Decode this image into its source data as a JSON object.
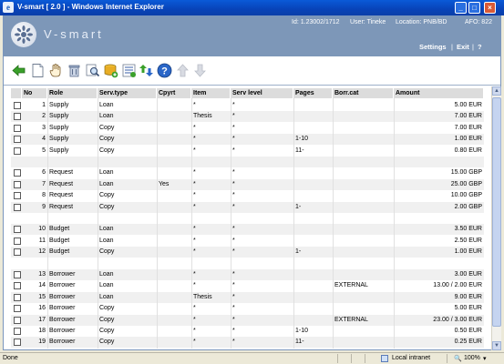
{
  "window": {
    "title": "V-smart [ 2.0 ] - Windows Internet Explorer"
  },
  "header": {
    "logo_text": "V-smart",
    "id_label": "Id:",
    "id_value": "1.23002/1712",
    "user_label": "User:",
    "user_value": "Tineke",
    "location_label": "Location:",
    "location_value": "PNB/BD",
    "afo_label": "AFO:",
    "afo_value": "822",
    "settings": "Settings",
    "separator": "|",
    "exit": "Exit",
    "separator2": "|",
    "help": "?"
  },
  "toolbar": {
    "icons": [
      "back-arrow-icon",
      "new-document-icon",
      "hand-select-icon",
      "delete-bin-icon",
      "search-details-icon",
      "add-record-icon",
      "list-icon",
      "transfer-icon",
      "help-icon",
      "move-up-icon",
      "move-down-icon"
    ]
  },
  "table": {
    "columns": [
      "No",
      "Role",
      "Serv.type",
      "Cpyrt",
      "Item",
      "Serv level",
      "Pages",
      "Borr.cat",
      "Amount"
    ],
    "rows": [
      {
        "no": "1",
        "role": "Supply",
        "serv_type": "Loan",
        "cpyrt": "",
        "item": "*",
        "serv_level": "*",
        "pages": "",
        "borr_cat": "",
        "amount": "5.00 EUR"
      },
      {
        "no": "2",
        "role": "Supply",
        "serv_type": "Loan",
        "cpyrt": "",
        "item": "Thesis",
        "serv_level": "*",
        "pages": "",
        "borr_cat": "",
        "amount": "7.00 EUR"
      },
      {
        "no": "3",
        "role": "Supply",
        "serv_type": "Copy",
        "cpyrt": "",
        "item": "*",
        "serv_level": "*",
        "pages": "",
        "borr_cat": "",
        "amount": "7.00 EUR"
      },
      {
        "no": "4",
        "role": "Supply",
        "serv_type": "Copy",
        "cpyrt": "",
        "item": "*",
        "serv_level": "*",
        "pages": "1-10",
        "borr_cat": "",
        "amount": "1.00 EUR"
      },
      {
        "no": "5",
        "role": "Supply",
        "serv_type": "Copy",
        "cpyrt": "",
        "item": "*",
        "serv_level": "*",
        "pages": "11-",
        "borr_cat": "",
        "amount": "0.80 EUR"
      },
      {
        "no": "",
        "role": "",
        "serv_type": "",
        "cpyrt": "",
        "item": "",
        "serv_level": "",
        "pages": "",
        "borr_cat": "",
        "amount": "",
        "blank": true
      },
      {
        "no": "6",
        "role": "Request",
        "serv_type": "Loan",
        "cpyrt": "",
        "item": "*",
        "serv_level": "*",
        "pages": "",
        "borr_cat": "",
        "amount": "15.00 GBP"
      },
      {
        "no": "7",
        "role": "Request",
        "serv_type": "Loan",
        "cpyrt": "Yes",
        "item": "*",
        "serv_level": "*",
        "pages": "",
        "borr_cat": "",
        "amount": "25.00 GBP"
      },
      {
        "no": "8",
        "role": "Request",
        "serv_type": "Copy",
        "cpyrt": "",
        "item": "*",
        "serv_level": "*",
        "pages": "",
        "borr_cat": "",
        "amount": "10.00 GBP"
      },
      {
        "no": "9",
        "role": "Request",
        "serv_type": "Copy",
        "cpyrt": "",
        "item": "*",
        "serv_level": "*",
        "pages": "1-",
        "borr_cat": "",
        "amount": "2.00 GBP"
      },
      {
        "no": "",
        "role": "",
        "serv_type": "",
        "cpyrt": "",
        "item": "",
        "serv_level": "",
        "pages": "",
        "borr_cat": "",
        "amount": "",
        "blank": true
      },
      {
        "no": "10",
        "role": "Budget",
        "serv_type": "Loan",
        "cpyrt": "",
        "item": "*",
        "serv_level": "*",
        "pages": "",
        "borr_cat": "",
        "amount": "3.50 EUR"
      },
      {
        "no": "11",
        "role": "Budget",
        "serv_type": "Loan",
        "cpyrt": "",
        "item": "*",
        "serv_level": "*",
        "pages": "",
        "borr_cat": "",
        "amount": "2.50 EUR"
      },
      {
        "no": "12",
        "role": "Budget",
        "serv_type": "Copy",
        "cpyrt": "",
        "item": "*",
        "serv_level": "*",
        "pages": "1-",
        "borr_cat": "",
        "amount": "1.00 EUR"
      },
      {
        "no": "",
        "role": "",
        "serv_type": "",
        "cpyrt": "",
        "item": "",
        "serv_level": "",
        "pages": "",
        "borr_cat": "",
        "amount": "",
        "blank": true
      },
      {
        "no": "13",
        "role": "Borrower",
        "serv_type": "Loan",
        "cpyrt": "",
        "item": "*",
        "serv_level": "*",
        "pages": "",
        "borr_cat": "",
        "amount": "3.00 EUR"
      },
      {
        "no": "14",
        "role": "Borrower",
        "serv_type": "Loan",
        "cpyrt": "",
        "item": "*",
        "serv_level": "*",
        "pages": "",
        "borr_cat": "EXTERNAL",
        "amount": "13.00 / 2.00 EUR"
      },
      {
        "no": "15",
        "role": "Borrower",
        "serv_type": "Loan",
        "cpyrt": "",
        "item": "Thesis",
        "serv_level": "*",
        "pages": "",
        "borr_cat": "",
        "amount": "9.00 EUR"
      },
      {
        "no": "16",
        "role": "Borrower",
        "serv_type": "Copy",
        "cpyrt": "",
        "item": "*",
        "serv_level": "*",
        "pages": "",
        "borr_cat": "",
        "amount": "5.00 EUR"
      },
      {
        "no": "17",
        "role": "Borrower",
        "serv_type": "Copy",
        "cpyrt": "",
        "item": "*",
        "serv_level": "*",
        "pages": "",
        "borr_cat": "EXTERNAL",
        "amount": "23.00 / 3.00 EUR"
      },
      {
        "no": "18",
        "role": "Borrower",
        "serv_type": "Copy",
        "cpyrt": "",
        "item": "*",
        "serv_level": "*",
        "pages": "1-10",
        "borr_cat": "",
        "amount": "0.50 EUR"
      },
      {
        "no": "19",
        "role": "Borrower",
        "serv_type": "Copy",
        "cpyrt": "",
        "item": "*",
        "serv_level": "*",
        "pages": "11-",
        "borr_cat": "",
        "amount": "0.25 EUR"
      }
    ]
  },
  "statusbar": {
    "status": "Done",
    "zone": "Local intranet",
    "zoom": "100%"
  },
  "colors": {
    "header_bg": "#7d97b8",
    "titlebar": "#0a5ad8",
    "toolbar_green": "#3aa02a",
    "help_blue": "#2a66c8"
  }
}
